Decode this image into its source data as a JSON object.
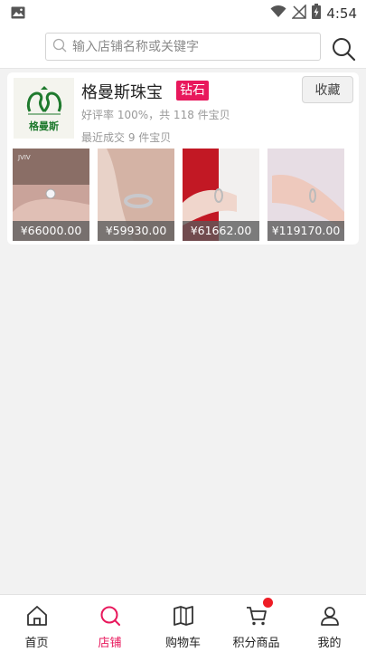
{
  "status_bar": {
    "time": "4:54",
    "icons": [
      "image-icon",
      "wifi-icon",
      "no-signal-icon",
      "battery-charging-icon"
    ]
  },
  "search": {
    "placeholder": "输入店铺名称或关键字",
    "value": ""
  },
  "shop": {
    "logo_text": "格曼斯",
    "name": "格曼斯珠宝",
    "badge": "钻石",
    "favorite_label": "收藏",
    "stats": "好评率 100%，共 118 件宝贝",
    "recent": "最近成交 9 件宝贝",
    "products": [
      {
        "price": "¥66000.00"
      },
      {
        "price": "¥59930.00"
      },
      {
        "price": "¥61662.00"
      },
      {
        "price": "¥119170.00"
      }
    ]
  },
  "tabbar": {
    "items": [
      {
        "label": "首页",
        "icon": "home-icon"
      },
      {
        "label": "店铺",
        "icon": "search-icon",
        "active": true
      },
      {
        "label": "购物车",
        "icon": "book-icon"
      },
      {
        "label": "积分商品",
        "icon": "cart-icon",
        "badge_dot": true
      },
      {
        "label": "我的",
        "icon": "user-icon"
      }
    ]
  },
  "colors": {
    "accent": "#e8185c",
    "badge_dot": "#ee1c25",
    "background": "#f2f2f2"
  }
}
